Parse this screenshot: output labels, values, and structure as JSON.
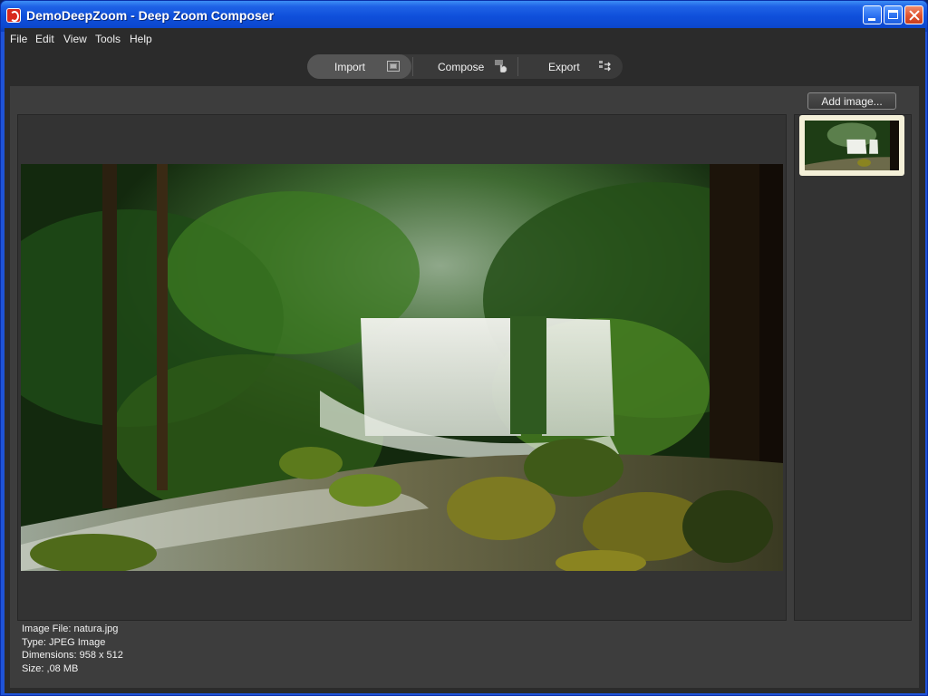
{
  "window": {
    "title": "DemoDeepZoom - Deep Zoom Composer"
  },
  "menu": {
    "items": [
      "File",
      "Edit",
      "View",
      "Tools",
      "Help"
    ]
  },
  "modes": {
    "import_label": "Import",
    "compose_label": "Compose",
    "export_label": "Export",
    "active": "Import"
  },
  "toolbar": {
    "add_image_label": "Add image..."
  },
  "info": {
    "file": "Image File: natura.jpg",
    "type": "Type: JPEG Image",
    "dimensions": "Dimensions: 958 x 512",
    "size": "Size: ,08 MB"
  },
  "icons": {
    "app": "deep-zoom-app-icon",
    "import": "import-image-icon",
    "compose": "hand-compose-icon",
    "export": "export-arrows-icon"
  }
}
